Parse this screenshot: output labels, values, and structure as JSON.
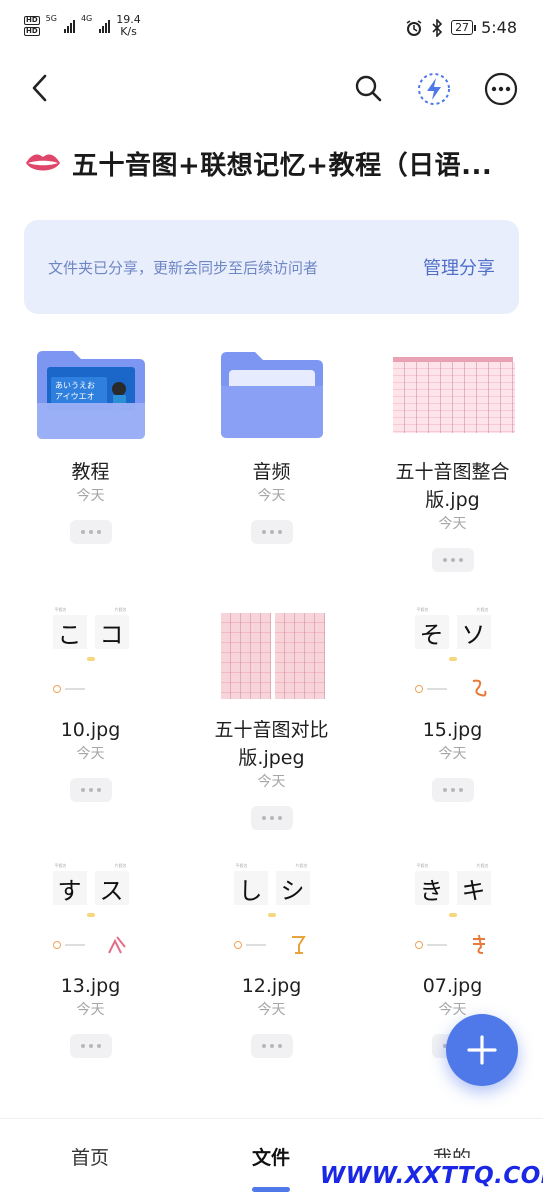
{
  "status_bar": {
    "sim1": "HD",
    "sim2": "HD",
    "net1": "5G",
    "net2": "4G",
    "speed_value": "19.4",
    "speed_unit": "K/s",
    "battery": "27",
    "time": "5:48"
  },
  "header": {
    "title": "五十音图+联想记忆+教程（日语..."
  },
  "share_banner": {
    "text": "文件夹已分享，更新会同步至后续访问者",
    "action": "管理分享"
  },
  "files": [
    {
      "name": "教程",
      "date": "今天",
      "type": "folder-video"
    },
    {
      "name": "音频",
      "date": "今天",
      "type": "folder"
    },
    {
      "name": "五十音图整合版.jpg",
      "date": "今天",
      "type": "table-wide"
    },
    {
      "name": "10.jpg",
      "date": "今天",
      "type": "kana",
      "kana": [
        "こ",
        "コ"
      ]
    },
    {
      "name": "五十音图对比版.jpeg",
      "date": "今天",
      "type": "table-tall"
    },
    {
      "name": "15.jpg",
      "date": "今天",
      "type": "kana",
      "kana": [
        "そ",
        "ソ"
      ]
    },
    {
      "name": "13.jpg",
      "date": "今天",
      "type": "kana",
      "kana": [
        "す",
        "ス"
      ]
    },
    {
      "name": "12.jpg",
      "date": "今天",
      "type": "kana",
      "kana": [
        "し",
        "シ"
      ]
    },
    {
      "name": "07.jpg",
      "date": "今天",
      "type": "kana",
      "kana": [
        "き",
        "キ"
      ]
    }
  ],
  "thumb_text": {
    "video_line1": "あいうえお",
    "video_line2": "アイウエオ",
    "kana_label_hira": "平假名",
    "kana_label_kata": "片假名"
  },
  "bottom_nav": {
    "home": "首页",
    "files": "文件",
    "mine": "我的"
  },
  "watermark": "WWW.XXTTQ.COM",
  "colors": {
    "accent": "#4f78e8",
    "banner_bg": "#e9eefc",
    "banner_text": "#6e86c4",
    "watermark": "#1a28e6"
  }
}
